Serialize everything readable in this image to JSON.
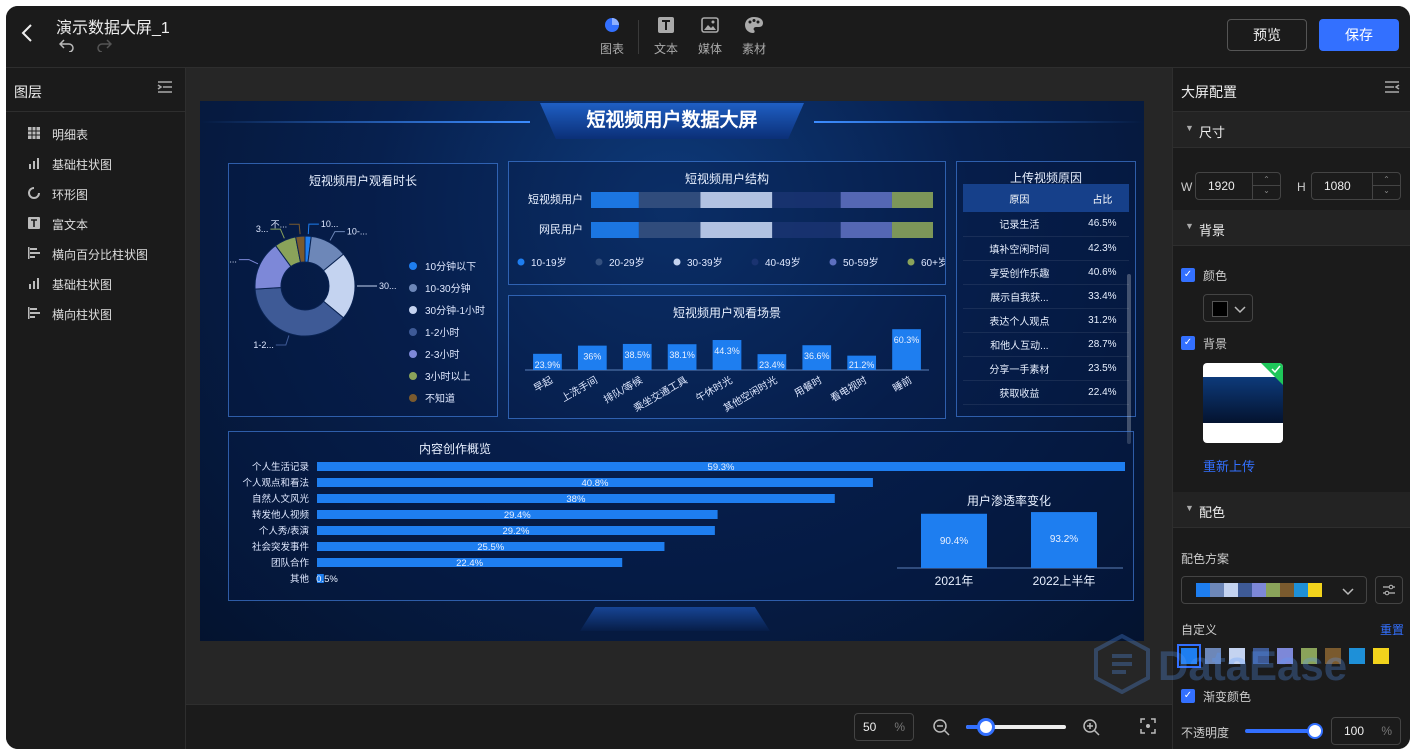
{
  "header": {
    "title": "演示数据大屏_1",
    "tools": [
      {
        "label": "图表",
        "icon": "pie-chart-icon"
      },
      {
        "label": "文本",
        "icon": "text-icon"
      },
      {
        "label": "媒体",
        "icon": "image-icon"
      },
      {
        "label": "素材",
        "icon": "palette-icon"
      }
    ],
    "preview_label": "预览",
    "save_label": "保存"
  },
  "layers": {
    "title": "图层",
    "items": [
      {
        "label": "明细表",
        "icon": "table-icon"
      },
      {
        "label": "基础柱状图",
        "icon": "bar-chart-icon"
      },
      {
        "label": "环形图",
        "icon": "ring-chart-icon"
      },
      {
        "label": "富文本",
        "icon": "text-icon"
      },
      {
        "label": "横向百分比柱状图",
        "icon": "hbar-chart-icon"
      },
      {
        "label": "基础柱状图",
        "icon": "bar-chart-icon"
      },
      {
        "label": "横向柱状图",
        "icon": "hbar-chart-icon"
      }
    ]
  },
  "config": {
    "title": "大屏配置",
    "size_label": "尺寸",
    "w_label": "W",
    "width": "1920",
    "h_label": "H",
    "height": "1080",
    "background_section": "背景",
    "color_label": "颜色",
    "color_value": "#000000",
    "bg_label": "背景",
    "reupload": "重新上传",
    "palette_section": "配色",
    "scheme_label": "配色方案",
    "custom_label": "自定义",
    "reset_label": "重置",
    "gradient_label": "渐变颜色",
    "opacity_label": "不透明度",
    "opacity_value": "100",
    "opacity_unit": "%",
    "colors": [
      "#1e7ef0",
      "#6d87b8",
      "#c4d3f0",
      "#3e5a96",
      "#7d88d8",
      "#8aa35a",
      "#7a5a2e",
      "#1e90d8",
      "#f2d31c"
    ]
  },
  "bottom": {
    "zoom": "50",
    "zoom_unit": "%",
    "zoom_level": 0.2
  },
  "screen": {
    "title": "短视频用户数据大屏",
    "watermark": "DataEase",
    "donut": {
      "title": "短视频用户观看时长",
      "chart_data": {
        "type": "pie",
        "legend": [
          "10分钟以下",
          "10-30分钟",
          "30分钟-1小时",
          "1-2小时",
          "2-3小时",
          "3小时以上",
          "不知道"
        ],
        "values": [
          2,
          12,
          22,
          38,
          16,
          7,
          3
        ],
        "colors": [
          "#1e7ef0",
          "#6d87b8",
          "#c4d3f0",
          "#3e5a96",
          "#7d88d8",
          "#8aa35a",
          "#7a5a2e"
        ],
        "labels": [
          "10...",
          "10-...",
          "30...",
          "1-2...",
          "2-3...",
          "3...",
          "不..."
        ]
      }
    },
    "structure": {
      "title": "短视频用户结构",
      "chart_data": {
        "type": "bar",
        "stacked": true,
        "orientation": "horizontal",
        "categories": [
          "短视频用户",
          "网民用户"
        ],
        "series": [
          {
            "name": "10-19岁",
            "values": [
              14,
              14
            ]
          },
          {
            "name": "20-29岁",
            "values": [
              18,
              18
            ]
          },
          {
            "name": "30-39岁",
            "values": [
              21,
              21
            ]
          },
          {
            "name": "40-49岁",
            "values": [
              20,
              20
            ]
          },
          {
            "name": "50-59岁",
            "values": [
              15,
              15
            ]
          },
          {
            "name": "60+岁",
            "values": [
              12,
              12
            ]
          }
        ],
        "colors": [
          "#1e7ef0",
          "#34507e",
          "#c4d3f0",
          "#1a3370",
          "#5d6fbf",
          "#8aa35a"
        ]
      }
    },
    "scene": {
      "title": "短视频用户观看场景",
      "chart_data": {
        "type": "bar",
        "categories": [
          "早起",
          "上洗手间",
          "排队/等候",
          "乘坐交通工具",
          "午休时光",
          "其他空闲时光",
          "用餐时",
          "看电视时",
          "睡前"
        ],
        "values": [
          23.9,
          36,
          38.5,
          38.1,
          44.3,
          23.4,
          36.6,
          21.2,
          60.3
        ],
        "labels": [
          "23.9%",
          "36%",
          "38.5%",
          "38.1%",
          "44.3%",
          "23.4%",
          "36.6%",
          "21.2%",
          "60.3%"
        ],
        "ylim": [
          0,
          65
        ]
      }
    },
    "upload": {
      "title": "上传视频原因",
      "headers": [
        "原因",
        "占比"
      ],
      "rows": [
        [
          "记录生活",
          "46.5%"
        ],
        [
          "填补空闲时间",
          "42.3%"
        ],
        [
          "享受创作乐趣",
          "40.6%"
        ],
        [
          "展示自我获...",
          "33.4%"
        ],
        [
          "表达个人观点",
          "31.2%"
        ],
        [
          "和他人互动...",
          "28.7%"
        ],
        [
          "分享一手素材",
          "23.5%"
        ],
        [
          "获取收益",
          "22.4%"
        ]
      ]
    },
    "creation": {
      "title": "内容创作概览",
      "chart_data": {
        "type": "bar",
        "orientation": "horizontal",
        "categories": [
          "个人生活记录",
          "个人观点和看法",
          "自然人文风光",
          "转发他人视频",
          "个人秀/表演",
          "社会突发事件",
          "团队合作",
          "其他"
        ],
        "values": [
          59.3,
          40.8,
          38,
          29.4,
          29.2,
          25.5,
          22.4,
          0.5
        ],
        "labels": [
          "59.3%",
          "40.8%",
          "38%",
          "29.4%",
          "29.2%",
          "25.5%",
          "22.4%",
          "0.5%"
        ],
        "xlim": [
          0,
          59.3
        ]
      }
    },
    "penetration": {
      "title": "用户渗透率变化",
      "chart_data": {
        "type": "bar",
        "categories": [
          "2021年",
          "2022上半年"
        ],
        "values": [
          90.4,
          93.2
        ],
        "labels": [
          "90.4%",
          "93.2%"
        ],
        "ylim": [
          0,
          100
        ]
      }
    }
  }
}
